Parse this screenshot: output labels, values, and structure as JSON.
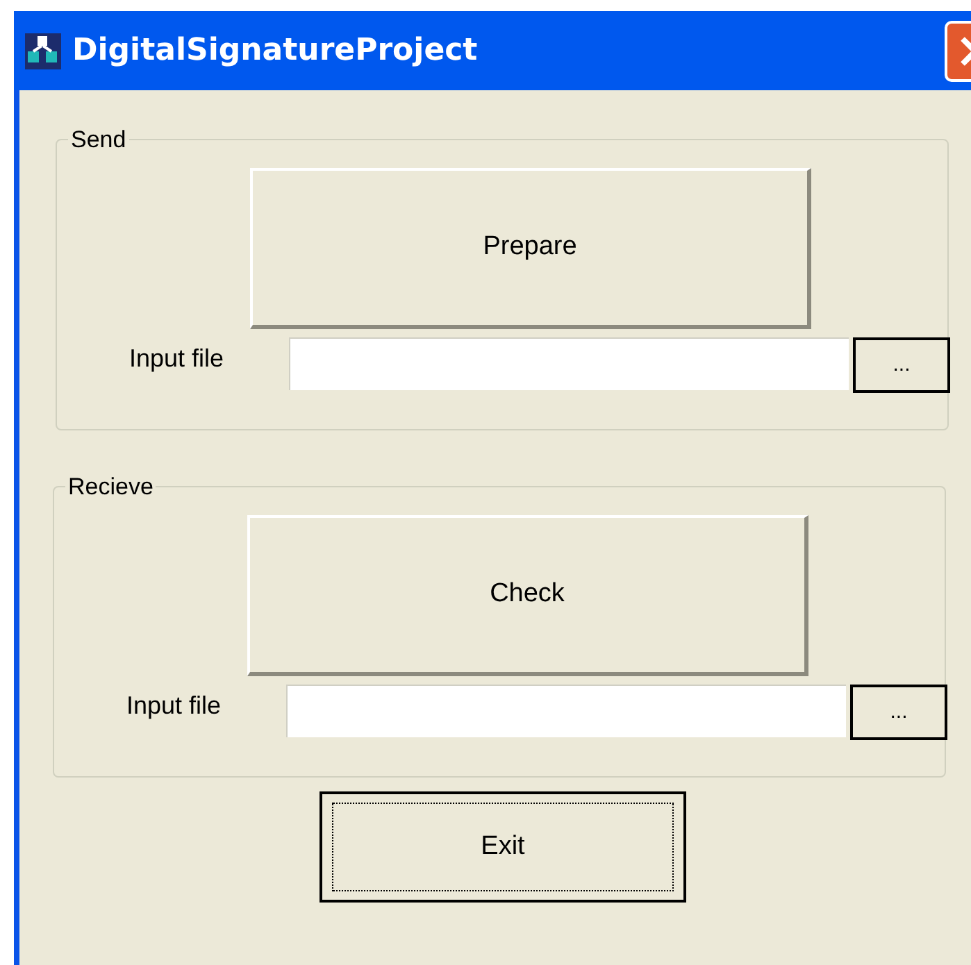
{
  "window": {
    "title": "DigitalSignatureProject"
  },
  "groups": [
    {
      "title": "Send",
      "action": "Prepare",
      "file_label": "Input file",
      "browse": "..."
    },
    {
      "title": "Recieve",
      "action": "Check",
      "file_label": "Input file",
      "browse": "..."
    }
  ],
  "exit": {
    "label": "Exit",
    "focused": true
  }
}
